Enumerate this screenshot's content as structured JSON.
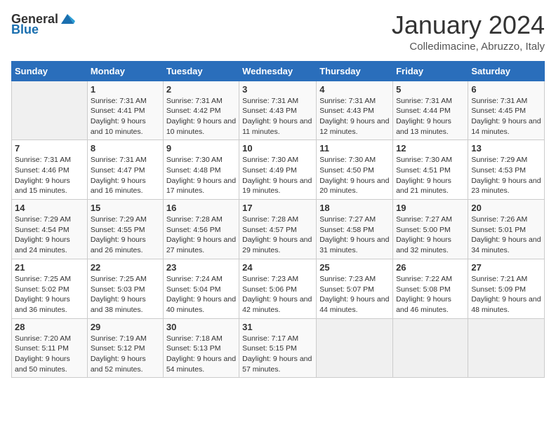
{
  "header": {
    "logo_general": "General",
    "logo_blue": "Blue",
    "month_title": "January 2024",
    "location": "Colledimacine, Abruzzo, Italy"
  },
  "weekdays": [
    "Sunday",
    "Monday",
    "Tuesday",
    "Wednesday",
    "Thursday",
    "Friday",
    "Saturday"
  ],
  "weeks": [
    [
      {
        "day": "",
        "empty": true
      },
      {
        "day": "1",
        "sunrise": "7:31 AM",
        "sunset": "4:41 PM",
        "daylight": "9 hours and 10 minutes."
      },
      {
        "day": "2",
        "sunrise": "7:31 AM",
        "sunset": "4:42 PM",
        "daylight": "9 hours and 10 minutes."
      },
      {
        "day": "3",
        "sunrise": "7:31 AM",
        "sunset": "4:43 PM",
        "daylight": "9 hours and 11 minutes."
      },
      {
        "day": "4",
        "sunrise": "7:31 AM",
        "sunset": "4:43 PM",
        "daylight": "9 hours and 12 minutes."
      },
      {
        "day": "5",
        "sunrise": "7:31 AM",
        "sunset": "4:44 PM",
        "daylight": "9 hours and 13 minutes."
      },
      {
        "day": "6",
        "sunrise": "7:31 AM",
        "sunset": "4:45 PM",
        "daylight": "9 hours and 14 minutes."
      }
    ],
    [
      {
        "day": "7",
        "sunrise": "7:31 AM",
        "sunset": "4:46 PM",
        "daylight": "9 hours and 15 minutes."
      },
      {
        "day": "8",
        "sunrise": "7:31 AM",
        "sunset": "4:47 PM",
        "daylight": "9 hours and 16 minutes."
      },
      {
        "day": "9",
        "sunrise": "7:30 AM",
        "sunset": "4:48 PM",
        "daylight": "9 hours and 17 minutes."
      },
      {
        "day": "10",
        "sunrise": "7:30 AM",
        "sunset": "4:49 PM",
        "daylight": "9 hours and 19 minutes."
      },
      {
        "day": "11",
        "sunrise": "7:30 AM",
        "sunset": "4:50 PM",
        "daylight": "9 hours and 20 minutes."
      },
      {
        "day": "12",
        "sunrise": "7:30 AM",
        "sunset": "4:51 PM",
        "daylight": "9 hours and 21 minutes."
      },
      {
        "day": "13",
        "sunrise": "7:29 AM",
        "sunset": "4:53 PM",
        "daylight": "9 hours and 23 minutes."
      }
    ],
    [
      {
        "day": "14",
        "sunrise": "7:29 AM",
        "sunset": "4:54 PM",
        "daylight": "9 hours and 24 minutes."
      },
      {
        "day": "15",
        "sunrise": "7:29 AM",
        "sunset": "4:55 PM",
        "daylight": "9 hours and 26 minutes."
      },
      {
        "day": "16",
        "sunrise": "7:28 AM",
        "sunset": "4:56 PM",
        "daylight": "9 hours and 27 minutes."
      },
      {
        "day": "17",
        "sunrise": "7:28 AM",
        "sunset": "4:57 PM",
        "daylight": "9 hours and 29 minutes."
      },
      {
        "day": "18",
        "sunrise": "7:27 AM",
        "sunset": "4:58 PM",
        "daylight": "9 hours and 31 minutes."
      },
      {
        "day": "19",
        "sunrise": "7:27 AM",
        "sunset": "5:00 PM",
        "daylight": "9 hours and 32 minutes."
      },
      {
        "day": "20",
        "sunrise": "7:26 AM",
        "sunset": "5:01 PM",
        "daylight": "9 hours and 34 minutes."
      }
    ],
    [
      {
        "day": "21",
        "sunrise": "7:25 AM",
        "sunset": "5:02 PM",
        "daylight": "9 hours and 36 minutes."
      },
      {
        "day": "22",
        "sunrise": "7:25 AM",
        "sunset": "5:03 PM",
        "daylight": "9 hours and 38 minutes."
      },
      {
        "day": "23",
        "sunrise": "7:24 AM",
        "sunset": "5:04 PM",
        "daylight": "9 hours and 40 minutes."
      },
      {
        "day": "24",
        "sunrise": "7:23 AM",
        "sunset": "5:06 PM",
        "daylight": "9 hours and 42 minutes."
      },
      {
        "day": "25",
        "sunrise": "7:23 AM",
        "sunset": "5:07 PM",
        "daylight": "9 hours and 44 minutes."
      },
      {
        "day": "26",
        "sunrise": "7:22 AM",
        "sunset": "5:08 PM",
        "daylight": "9 hours and 46 minutes."
      },
      {
        "day": "27",
        "sunrise": "7:21 AM",
        "sunset": "5:09 PM",
        "daylight": "9 hours and 48 minutes."
      }
    ],
    [
      {
        "day": "28",
        "sunrise": "7:20 AM",
        "sunset": "5:11 PM",
        "daylight": "9 hours and 50 minutes."
      },
      {
        "day": "29",
        "sunrise": "7:19 AM",
        "sunset": "5:12 PM",
        "daylight": "9 hours and 52 minutes."
      },
      {
        "day": "30",
        "sunrise": "7:18 AM",
        "sunset": "5:13 PM",
        "daylight": "9 hours and 54 minutes."
      },
      {
        "day": "31",
        "sunrise": "7:17 AM",
        "sunset": "5:15 PM",
        "daylight": "9 hours and 57 minutes."
      },
      {
        "day": "",
        "empty": true
      },
      {
        "day": "",
        "empty": true
      },
      {
        "day": "",
        "empty": true
      }
    ]
  ],
  "labels": {
    "sunrise": "Sunrise:",
    "sunset": "Sunset:",
    "daylight": "Daylight hours"
  }
}
